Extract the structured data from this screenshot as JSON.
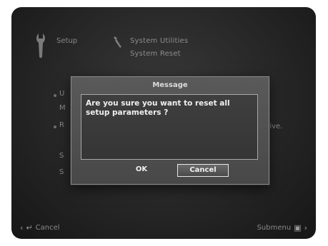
{
  "background": {
    "breadcrumb": {
      "setup_label": "Setup",
      "utilities_label": "System Utilities",
      "reset_label": "System Reset"
    },
    "menu_items": [
      {
        "text": "U"
      },
      {
        "text": "M"
      },
      {
        "text": "R"
      },
      {
        "text": "S"
      },
      {
        "text": "S"
      }
    ],
    "archive_fragment": "hive."
  },
  "footer": {
    "cancel_label": "Cancel",
    "submenu_label": "Submenu",
    "left_arrow_icon": "chevron-left-icon",
    "return_icon": "return-icon",
    "submenu_icon": "submenu-icon",
    "right_arrow_icon": "chevron-right-icon"
  },
  "dialog": {
    "title": "Message",
    "message": "Are you sure you want to reset all setup parameters ?",
    "ok_label": "OK",
    "cancel_label": "Cancel",
    "selected_button": "Cancel"
  }
}
